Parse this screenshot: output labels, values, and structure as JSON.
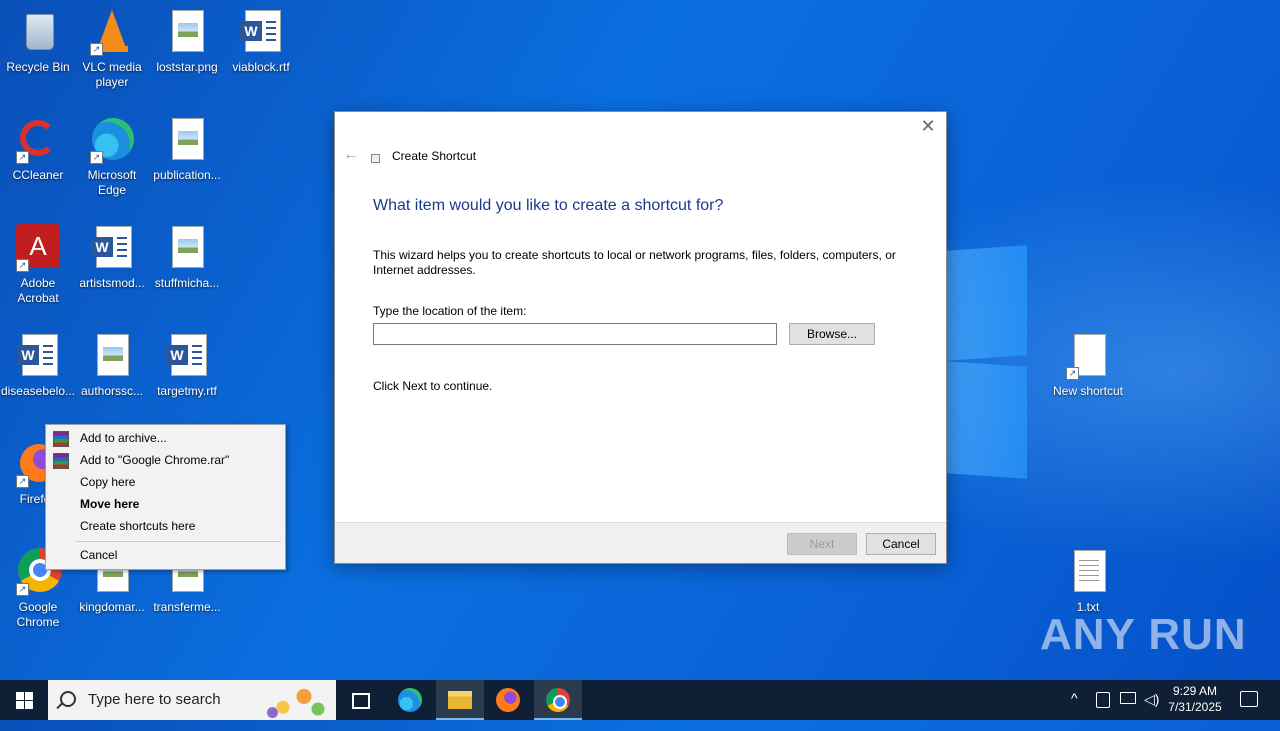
{
  "desktop": {
    "icons": [
      {
        "label": "Recycle Bin"
      },
      {
        "label": "VLC media player"
      },
      {
        "label": "loststar.png"
      },
      {
        "label": "viablock.rtf"
      },
      {
        "label": "CCleaner"
      },
      {
        "label": "Microsoft Edge"
      },
      {
        "label": "publication..."
      },
      {
        "label": "Adobe Acrobat"
      },
      {
        "label": "artistsmod..."
      },
      {
        "label": "stuffmicha..."
      },
      {
        "label": "diseasebelo..."
      },
      {
        "label": "authorssc..."
      },
      {
        "label": "targetmy.rtf"
      },
      {
        "label": "Firefox"
      },
      {
        "label": "Google Chrome"
      },
      {
        "label": "kingdomar..."
      },
      {
        "label": "transferme..."
      },
      {
        "label": "New shortcut"
      },
      {
        "label": "1.txt"
      }
    ]
  },
  "wizard": {
    "window_title": "Create Shortcut",
    "heading": "What item would you like to create a shortcut for?",
    "description": "This wizard helps you to create shortcuts to local or network programs, files, folders, computers, or Internet addresses.",
    "location_label": "Type the location of the item:",
    "location_value": "",
    "browse_label": "Browse...",
    "hint": "Click Next to continue.",
    "next_label": "Next",
    "cancel_label": "Cancel",
    "close_glyph": "✕",
    "back_glyph": "←"
  },
  "context_menu": {
    "items": [
      {
        "label": "Add to archive...",
        "icon": "winrar-icon"
      },
      {
        "label": "Add to \"Google Chrome.rar\"",
        "icon": "winrar-icon"
      },
      {
        "label": "Copy here"
      },
      {
        "label": "Move here",
        "bold": true
      },
      {
        "label": "Create shortcuts here"
      },
      {
        "label": "Cancel"
      }
    ]
  },
  "taskbar": {
    "search_placeholder": "Type here to search",
    "time": "9:29 AM",
    "date": "7/31/2025"
  },
  "watermark": "ANY RUN",
  "colors": {
    "desktop_blue": "#0a62d6",
    "taskbar": "#0f1f35",
    "heading_blue": "#1a3a8f"
  }
}
